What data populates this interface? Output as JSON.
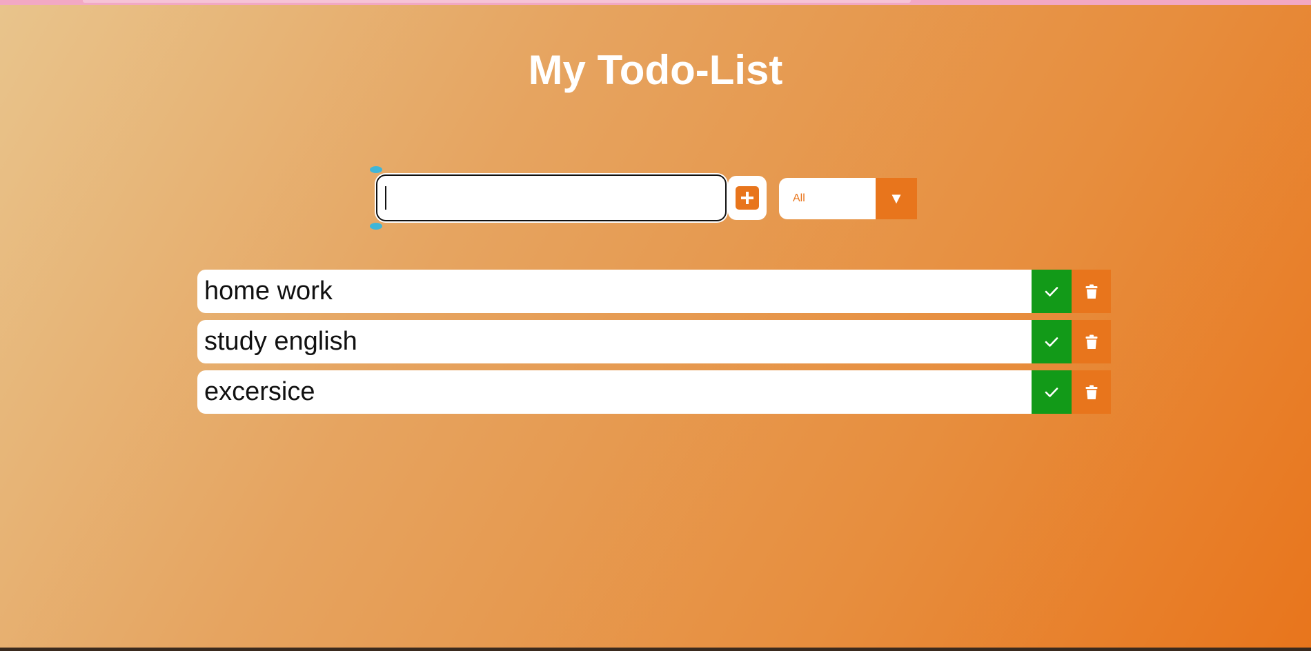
{
  "header": {
    "title": "My Todo-List"
  },
  "entry": {
    "input_value": "",
    "add_icon": "plus-icon"
  },
  "filter": {
    "selected": "All",
    "arrow_icon": "triangle-down-icon"
  },
  "todos": [
    {
      "text": "home work"
    },
    {
      "text": "study english"
    },
    {
      "text": "excersice"
    }
  ],
  "colors": {
    "accent": "#e8751c",
    "complete": "#129a18",
    "text": "#111111",
    "title": "#ffffff"
  }
}
